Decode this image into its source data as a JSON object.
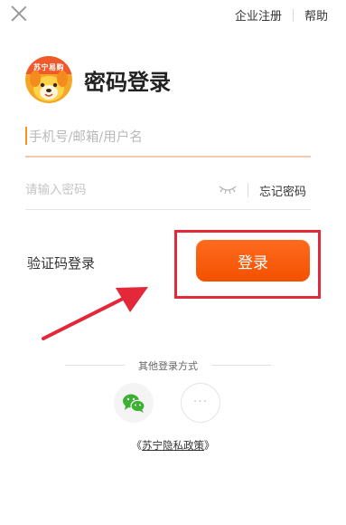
{
  "header": {
    "enterprise_register": "企业注册",
    "help": "帮助"
  },
  "logo": {
    "text": "苏宁易购"
  },
  "title": "密码登录",
  "form": {
    "account_placeholder": "手机号/邮箱/用户名",
    "password_placeholder": "请输入密码",
    "forgot_password": "忘记密码"
  },
  "sms_login": "验证码登录",
  "login_button": "登录",
  "other_login": {
    "label": "其他登录方式",
    "more": "···"
  },
  "privacy": {
    "open_bracket": "《",
    "link": "苏宁隐私政策",
    "close_bracket": "》"
  },
  "colors": {
    "accent": "#f25100",
    "annotation_red": "#e3283a",
    "wechat_green": "#3cb034"
  },
  "icons": [
    "close-icon",
    "eye-closed-icon",
    "wechat-icon",
    "more-icon",
    "suning-logo-icon"
  ]
}
